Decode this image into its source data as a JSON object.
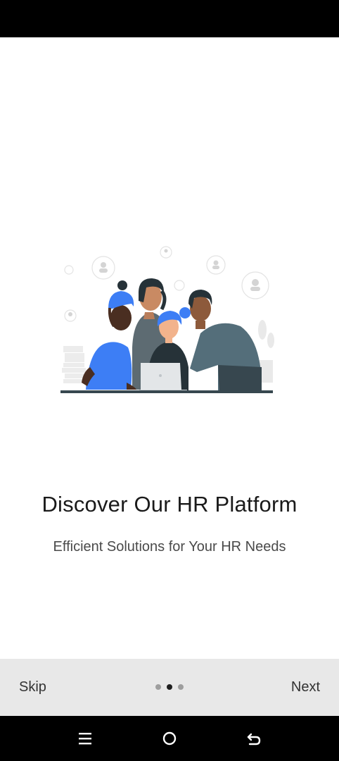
{
  "onboarding": {
    "title": "Discover Our HR Platform",
    "subtitle": "Efficient Solutions for Your HR Needs",
    "illustration_icon": "team-collaboration-illustration"
  },
  "footer": {
    "skip_label": "Skip",
    "next_label": "Next",
    "page_indicator": {
      "total": 3,
      "current": 2
    }
  },
  "system_nav": {
    "icons": [
      "recent-apps-icon",
      "home-icon",
      "back-icon"
    ]
  },
  "colors": {
    "accent_blue": "#3d7ef5",
    "dark_slate": "#37474f",
    "footer_bg": "#e8e8e8"
  }
}
